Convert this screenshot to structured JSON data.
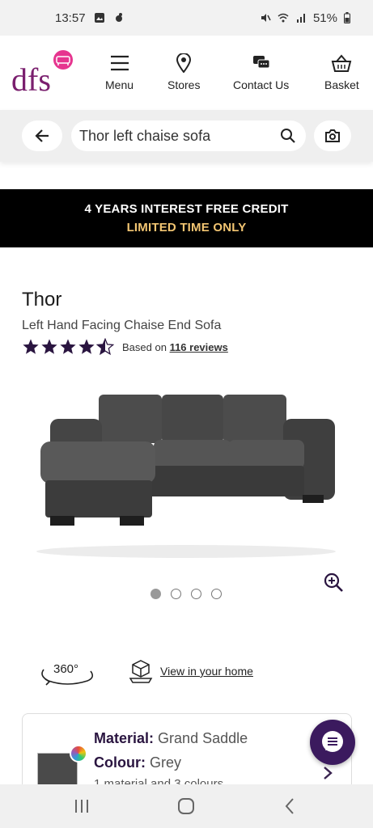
{
  "status_bar": {
    "time": "13:57",
    "battery": "51%"
  },
  "header": {
    "logo_text": "dfs",
    "nav": [
      {
        "label": "Menu",
        "icon": "menu-icon"
      },
      {
        "label": "Stores",
        "icon": "location-pin-icon"
      },
      {
        "label": "Contact Us",
        "icon": "chat-bubbles-icon"
      },
      {
        "label": "Basket",
        "icon": "basket-icon"
      }
    ]
  },
  "search": {
    "value": "Thor left chaise sofa"
  },
  "promo": {
    "line1": "4 YEARS INTEREST FREE CREDIT",
    "line2": "LIMITED TIME ONLY"
  },
  "product": {
    "title": "Thor",
    "subtitle": "Left Hand Facing Chaise End Sofa",
    "rating": 4.5,
    "rating_prefix": "Based on",
    "reviews_link": "116 reviews",
    "gallery_count": 4,
    "gallery_active": 1
  },
  "features": {
    "view360_label": "360°",
    "ar_link": "View in your home"
  },
  "card": {
    "material_label": "Material:",
    "material_value": "Grand Saddle",
    "colour_label": "Colour:",
    "colour_value": "Grey",
    "summary": "1 material and 3 colours"
  },
  "colors": {
    "brand": "#7a1f6e",
    "accent_pink": "#e6358f",
    "chat": "#3b1a5e",
    "promo_gold": "#f2c572"
  }
}
